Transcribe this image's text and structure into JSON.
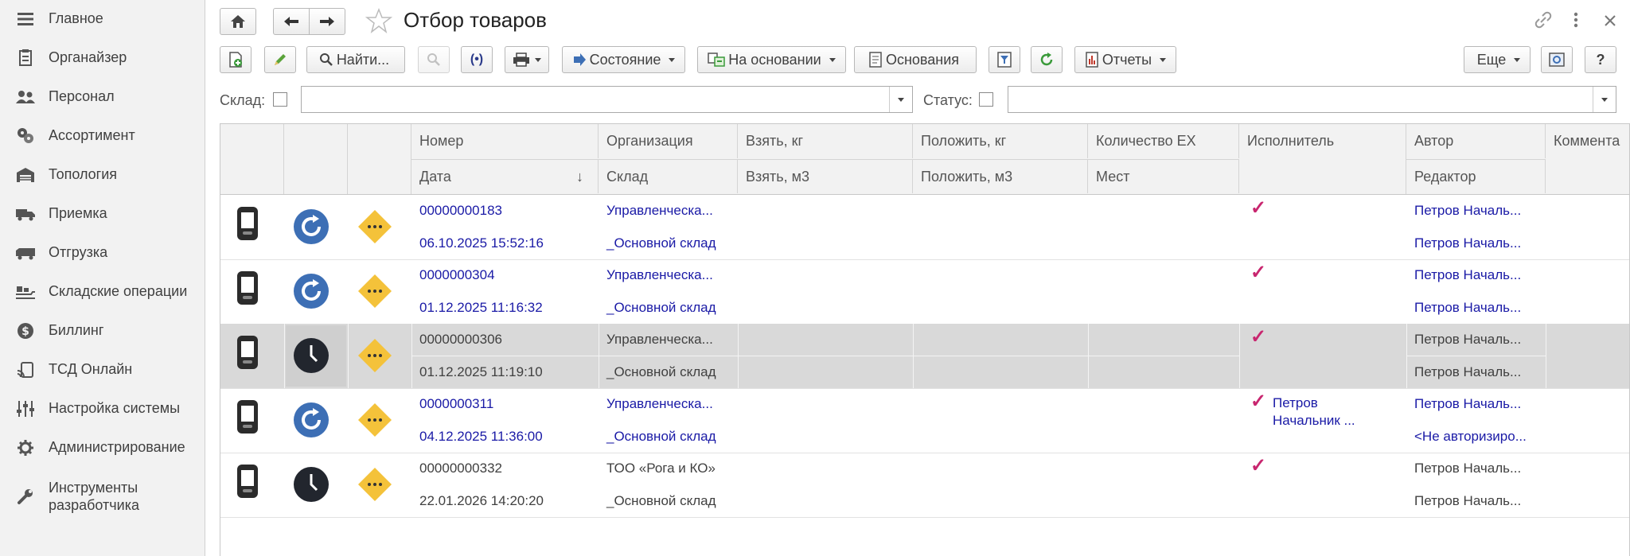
{
  "sidebar": {
    "items": [
      {
        "label": "Главное",
        "icon": "menu-icon"
      },
      {
        "label": "Органайзер",
        "icon": "organizer-icon"
      },
      {
        "label": "Персонал",
        "icon": "people-icon"
      },
      {
        "label": "Ассортимент",
        "icon": "assortment-icon"
      },
      {
        "label": "Топология",
        "icon": "warehouse-icon"
      },
      {
        "label": "Приемка",
        "icon": "receiving-icon"
      },
      {
        "label": "Отгрузка",
        "icon": "shipping-icon"
      },
      {
        "label": "Складские операции",
        "icon": "warehouse-ops-icon"
      },
      {
        "label": "Биллинг",
        "icon": "dollar-icon"
      },
      {
        "label": "ТСД Онлайн",
        "icon": "tsd-icon"
      },
      {
        "label": "Настройка системы",
        "icon": "sliders-icon"
      },
      {
        "label": "Администрирование",
        "icon": "gear-icon"
      },
      {
        "label": "Инструменты\nразработчика",
        "icon": "wrench-icon"
      }
    ]
  },
  "header": {
    "title": "Отбор товаров"
  },
  "toolbar": {
    "find_label": "Найти...",
    "state_label": "Состояние",
    "based_on_label": "На основании",
    "bases_label": "Основания",
    "reports_label": "Отчеты",
    "more_label": "Еще",
    "help_label": "?"
  },
  "filters": {
    "warehouse_label": "Склад:",
    "status_label": "Статус:",
    "warehouse_value": "",
    "status_value": ""
  },
  "table": {
    "headers_top": [
      "Номер",
      "Организация",
      "Взять, кг",
      "Положить, кг",
      "Количество ЕХ",
      "Исполнитель",
      "Автор",
      "Коммента"
    ],
    "headers_bottom": [
      "Дата",
      "Склад",
      "Взять, м3",
      "Положить, м3",
      "Мест",
      "",
      "Редактор",
      ""
    ],
    "sort_arrow": "↓",
    "rows": [
      {
        "number": "00000000183",
        "date": "06.10.2025 15:52:16",
        "org": "Управленческа...",
        "warehouse": "_Основной склад",
        "executor": "",
        "author": "Петров Началь...",
        "editor": "Петров Началь...",
        "status": "refresh",
        "style": "link"
      },
      {
        "number": "0000000304",
        "date": "01.12.2025 11:16:32",
        "org": "Управленческа...",
        "warehouse": "_Основной склад",
        "executor": "",
        "author": "Петров Началь...",
        "editor": "Петров Началь...",
        "status": "refresh",
        "style": "link"
      },
      {
        "number": "00000000306",
        "date": "01.12.2025 11:19:10",
        "org": "Управленческа...",
        "warehouse": "_Основной склад",
        "executor": "",
        "author": "Петров Началь...",
        "editor": "Петров Началь...",
        "status": "clock",
        "style": "plain"
      },
      {
        "number": "0000000311",
        "date": "04.12.2025 11:36:00",
        "org": "Управленческа...",
        "warehouse": "_Основной склад",
        "executor": "Петров\nНачальник ...",
        "author": "Петров Началь...",
        "editor": "<Не авторизиро...",
        "status": "refresh",
        "style": "link"
      },
      {
        "number": "00000000332",
        "date": "22.01.2026 14:20:20",
        "org": "ТОО «Рога и КО»",
        "warehouse": "_Основной склад",
        "executor": "",
        "author": "Петров Началь...",
        "editor": "Петров Началь...",
        "status": "clock",
        "style": "plain"
      }
    ]
  },
  "colors": {
    "link": "#1a1aa6",
    "check": "#c8266f",
    "diamond": "#f4c23a",
    "refresh_icon": "#3d6fb5",
    "clock_icon": "#22262e",
    "selected_row": "#d9d9d9"
  }
}
